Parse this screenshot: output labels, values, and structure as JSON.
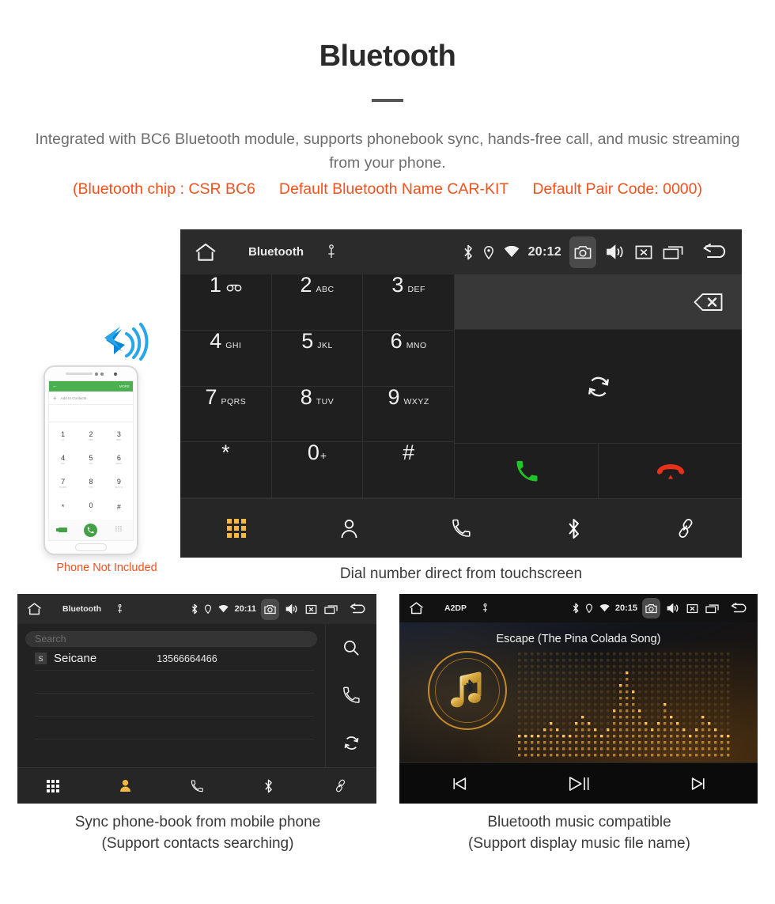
{
  "header": {
    "title": "Bluetooth",
    "intro": "Integrated with BC6 Bluetooth module, supports phonebook sync, hands-free call, and music streaming from your phone.",
    "spec_chip": "(Bluetooth chip : CSR BC6",
    "spec_name": "Default Bluetooth Name CAR-KIT",
    "spec_pair": "Default Pair Code: 0000)",
    "accent_color": "#f4511e",
    "body_color": "#6e6e6e"
  },
  "phone_mock": {
    "caption": "Phone Not Included",
    "app_more": "MORE",
    "add_contacts": "Add to Contacts",
    "keys": [
      {
        "num": "1",
        "letters": "oo"
      },
      {
        "num": "2",
        "letters": "ABC"
      },
      {
        "num": "3",
        "letters": "DEF"
      },
      {
        "num": "4",
        "letters": "GHI"
      },
      {
        "num": "5",
        "letters": "JKL"
      },
      {
        "num": "6",
        "letters": "MNO"
      },
      {
        "num": "7",
        "letters": "PQRS"
      },
      {
        "num": "8",
        "letters": "TUV"
      },
      {
        "num": "9",
        "letters": "WXYZ"
      },
      {
        "num": "*",
        "letters": ""
      },
      {
        "num": "0",
        "letters": "+"
      },
      {
        "num": "#",
        "letters": ""
      }
    ]
  },
  "dialer_screen": {
    "status": {
      "app_title": "Bluetooth",
      "time": "20:12",
      "icons": [
        "home-icon",
        "usb-icon",
        "bluetooth-icon",
        "location-icon",
        "wifi-icon",
        "camera-icon",
        "volume-icon",
        "close-box-icon",
        "recent-apps-icon",
        "back-icon"
      ]
    },
    "keys": [
      {
        "num": "1",
        "letters": "",
        "voicemail": true
      },
      {
        "num": "2",
        "letters": "ABC"
      },
      {
        "num": "3",
        "letters": "DEF"
      },
      {
        "num": "4",
        "letters": "GHI"
      },
      {
        "num": "5",
        "letters": "JKL"
      },
      {
        "num": "6",
        "letters": "MNO"
      },
      {
        "num": "7",
        "letters": "PQRS"
      },
      {
        "num": "8",
        "letters": "TUV"
      },
      {
        "num": "9",
        "letters": "WXYZ"
      },
      {
        "num": "*",
        "letters": ""
      },
      {
        "num": "0",
        "letters": "",
        "plus": "+"
      },
      {
        "num": "#",
        "letters": ""
      }
    ],
    "number_value": "",
    "nav": [
      "dialpad-icon",
      "contacts-icon",
      "call-log-icon",
      "bluetooth-icon",
      "link-icon"
    ],
    "active_nav": "dialpad-icon",
    "active_color": "#f4b942",
    "call_color": "#22c32a",
    "hangup_color": "#e8311a",
    "caption": "Dial number direct from touchscreen"
  },
  "phonebook_screen": {
    "status": {
      "app_title": "Bluetooth",
      "time": "20:11"
    },
    "search_placeholder": "Search",
    "search_value": "",
    "contacts": [
      {
        "initial": "S",
        "name": "Seicane",
        "number": "13566664466"
      }
    ],
    "side_actions": [
      "search-icon",
      "call-icon",
      "sync-icon"
    ],
    "nav": [
      "dialpad-icon",
      "contacts-icon",
      "call-log-icon",
      "bluetooth-icon",
      "link-icon"
    ],
    "active_nav": "contacts-icon",
    "caption_line1": "Sync phone-book from mobile phone",
    "caption_line2": "(Support contacts searching)"
  },
  "music_screen": {
    "status": {
      "app_title": "A2DP",
      "time": "20:15"
    },
    "song_title": "Escape (The Pina Colada Song)",
    "controls": [
      "previous-icon",
      "play-pause-icon",
      "next-icon"
    ],
    "accent_color": "#d9a43a",
    "caption_line1": "Bluetooth music compatible",
    "caption_line2": "(Support display music file name)"
  }
}
